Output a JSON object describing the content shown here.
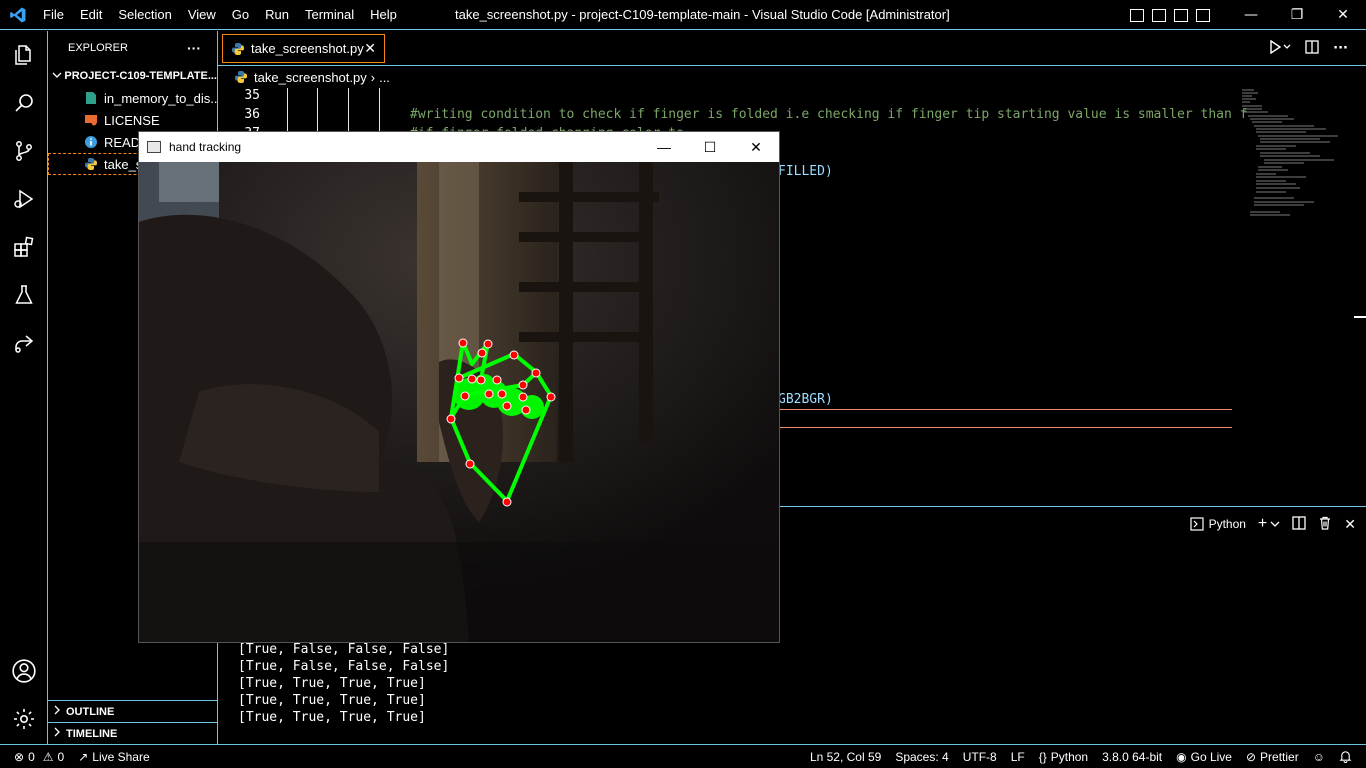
{
  "titlebar": {
    "menu": [
      "File",
      "Edit",
      "Selection",
      "View",
      "Go",
      "Run",
      "Terminal",
      "Help"
    ],
    "title": "take_screenshot.py - project-C109-template-main - Visual Studio Code [Administrator]",
    "minimize": "—",
    "restore": "❐",
    "close": "✕"
  },
  "sidebar": {
    "header": "EXPLORER",
    "more": "···",
    "folder": "PROJECT-C109-TEMPLATE...",
    "files": [
      {
        "name": "in_memory_to_dis...",
        "icon": "file-icon"
      },
      {
        "name": "LICENSE",
        "icon": "license-icon"
      },
      {
        "name": "READ",
        "icon": "info-icon"
      },
      {
        "name": "take_s",
        "icon": "python-icon"
      }
    ],
    "outline": "OUTLINE",
    "timeline": "TIMELINE"
  },
  "editor": {
    "tab_label": "take_screenshot.py",
    "tab_close": "✕",
    "breadcrumb_file": "take_screenshot.py",
    "breadcrumb_more": "...",
    "line_numbers": [
      "35",
      "36",
      "37"
    ],
    "code": {
      "comment1": "#writing condition to check if finger is folded i.e checking if finger tip starting value is smaller than f",
      "comment2": "#if finger folded changing color to",
      "frag_filled": "FILLED)",
      "frag_bgr": "GB2BGR)"
    }
  },
  "panel": {
    "shell_label": "Python",
    "plus": "+",
    "output": [
      "[True, False, False, False]",
      "[True, False, False, False]",
      "[True, True, True, True]",
      "[True, True, True, True]",
      "[True, True, True, True]"
    ]
  },
  "statusbar": {
    "errors": "0",
    "warnings": "0",
    "live_share": "Live Share",
    "position": "Ln 52, Col 59",
    "spaces": "Spaces: 4",
    "encoding": "UTF-8",
    "eol": "LF",
    "language": "Python",
    "interpreter": "3.8.0 64-bit",
    "go_live": "Go Live",
    "prettier": "Prettier"
  },
  "hand_window": {
    "title": "hand tracking",
    "minimize": "—",
    "maximize": "☐",
    "close": "✕"
  },
  "colors": {
    "accent_border": "#6fc3df",
    "tab_border": "#f38518",
    "landmark_green": "#00ff00",
    "landmark_red": "#ff0000"
  }
}
